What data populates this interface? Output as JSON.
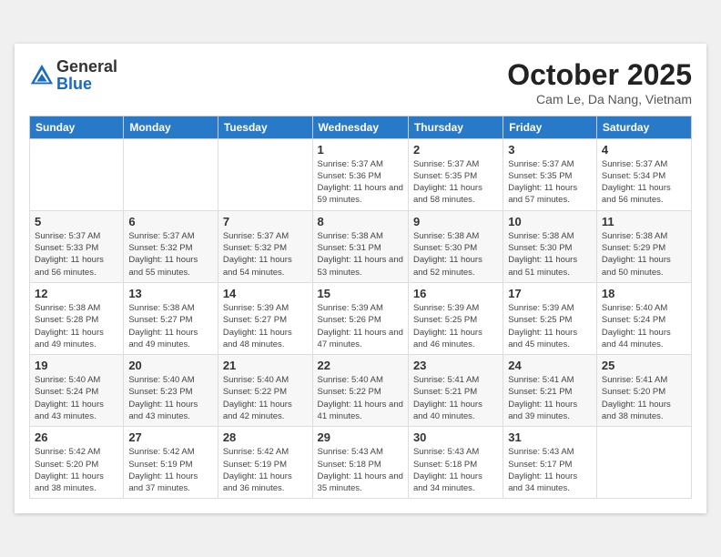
{
  "header": {
    "logo_general": "General",
    "logo_blue": "Blue",
    "month_title": "October 2025",
    "location": "Cam Le, Da Nang, Vietnam"
  },
  "weekdays": [
    "Sunday",
    "Monday",
    "Tuesday",
    "Wednesday",
    "Thursday",
    "Friday",
    "Saturday"
  ],
  "weeks": [
    [
      {
        "day": "",
        "sunrise": "",
        "sunset": "",
        "daylight": ""
      },
      {
        "day": "",
        "sunrise": "",
        "sunset": "",
        "daylight": ""
      },
      {
        "day": "",
        "sunrise": "",
        "sunset": "",
        "daylight": ""
      },
      {
        "day": "1",
        "sunrise": "5:37 AM",
        "sunset": "5:36 PM",
        "daylight": "11 hours and 59 minutes."
      },
      {
        "day": "2",
        "sunrise": "5:37 AM",
        "sunset": "5:35 PM",
        "daylight": "11 hours and 58 minutes."
      },
      {
        "day": "3",
        "sunrise": "5:37 AM",
        "sunset": "5:35 PM",
        "daylight": "11 hours and 57 minutes."
      },
      {
        "day": "4",
        "sunrise": "5:37 AM",
        "sunset": "5:34 PM",
        "daylight": "11 hours and 56 minutes."
      }
    ],
    [
      {
        "day": "5",
        "sunrise": "5:37 AM",
        "sunset": "5:33 PM",
        "daylight": "11 hours and 56 minutes."
      },
      {
        "day": "6",
        "sunrise": "5:37 AM",
        "sunset": "5:32 PM",
        "daylight": "11 hours and 55 minutes."
      },
      {
        "day": "7",
        "sunrise": "5:37 AM",
        "sunset": "5:32 PM",
        "daylight": "11 hours and 54 minutes."
      },
      {
        "day": "8",
        "sunrise": "5:38 AM",
        "sunset": "5:31 PM",
        "daylight": "11 hours and 53 minutes."
      },
      {
        "day": "9",
        "sunrise": "5:38 AM",
        "sunset": "5:30 PM",
        "daylight": "11 hours and 52 minutes."
      },
      {
        "day": "10",
        "sunrise": "5:38 AM",
        "sunset": "5:30 PM",
        "daylight": "11 hours and 51 minutes."
      },
      {
        "day": "11",
        "sunrise": "5:38 AM",
        "sunset": "5:29 PM",
        "daylight": "11 hours and 50 minutes."
      }
    ],
    [
      {
        "day": "12",
        "sunrise": "5:38 AM",
        "sunset": "5:28 PM",
        "daylight": "11 hours and 49 minutes."
      },
      {
        "day": "13",
        "sunrise": "5:38 AM",
        "sunset": "5:27 PM",
        "daylight": "11 hours and 49 minutes."
      },
      {
        "day": "14",
        "sunrise": "5:39 AM",
        "sunset": "5:27 PM",
        "daylight": "11 hours and 48 minutes."
      },
      {
        "day": "15",
        "sunrise": "5:39 AM",
        "sunset": "5:26 PM",
        "daylight": "11 hours and 47 minutes."
      },
      {
        "day": "16",
        "sunrise": "5:39 AM",
        "sunset": "5:25 PM",
        "daylight": "11 hours and 46 minutes."
      },
      {
        "day": "17",
        "sunrise": "5:39 AM",
        "sunset": "5:25 PM",
        "daylight": "11 hours and 45 minutes."
      },
      {
        "day": "18",
        "sunrise": "5:40 AM",
        "sunset": "5:24 PM",
        "daylight": "11 hours and 44 minutes."
      }
    ],
    [
      {
        "day": "19",
        "sunrise": "5:40 AM",
        "sunset": "5:24 PM",
        "daylight": "11 hours and 43 minutes."
      },
      {
        "day": "20",
        "sunrise": "5:40 AM",
        "sunset": "5:23 PM",
        "daylight": "11 hours and 43 minutes."
      },
      {
        "day": "21",
        "sunrise": "5:40 AM",
        "sunset": "5:22 PM",
        "daylight": "11 hours and 42 minutes."
      },
      {
        "day": "22",
        "sunrise": "5:40 AM",
        "sunset": "5:22 PM",
        "daylight": "11 hours and 41 minutes."
      },
      {
        "day": "23",
        "sunrise": "5:41 AM",
        "sunset": "5:21 PM",
        "daylight": "11 hours and 40 minutes."
      },
      {
        "day": "24",
        "sunrise": "5:41 AM",
        "sunset": "5:21 PM",
        "daylight": "11 hours and 39 minutes."
      },
      {
        "day": "25",
        "sunrise": "5:41 AM",
        "sunset": "5:20 PM",
        "daylight": "11 hours and 38 minutes."
      }
    ],
    [
      {
        "day": "26",
        "sunrise": "5:42 AM",
        "sunset": "5:20 PM",
        "daylight": "11 hours and 38 minutes."
      },
      {
        "day": "27",
        "sunrise": "5:42 AM",
        "sunset": "5:19 PM",
        "daylight": "11 hours and 37 minutes."
      },
      {
        "day": "28",
        "sunrise": "5:42 AM",
        "sunset": "5:19 PM",
        "daylight": "11 hours and 36 minutes."
      },
      {
        "day": "29",
        "sunrise": "5:43 AM",
        "sunset": "5:18 PM",
        "daylight": "11 hours and 35 minutes."
      },
      {
        "day": "30",
        "sunrise": "5:43 AM",
        "sunset": "5:18 PM",
        "daylight": "11 hours and 34 minutes."
      },
      {
        "day": "31",
        "sunrise": "5:43 AM",
        "sunset": "5:17 PM",
        "daylight": "11 hours and 34 minutes."
      },
      {
        "day": "",
        "sunrise": "",
        "sunset": "",
        "daylight": ""
      }
    ]
  ]
}
